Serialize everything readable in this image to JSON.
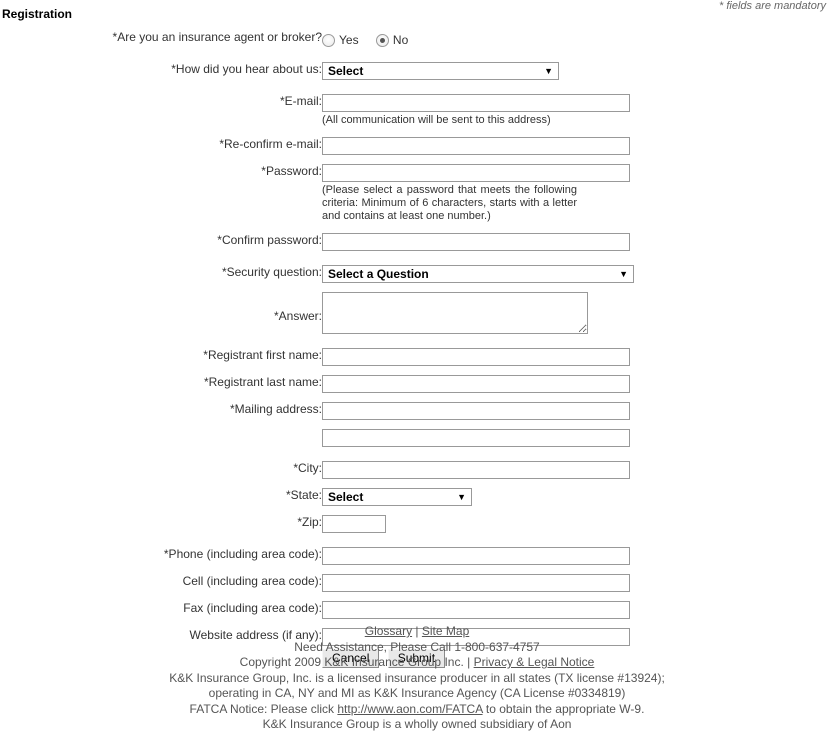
{
  "page": {
    "title": "Registration",
    "mandatory_note": "* fields are mandatory"
  },
  "form": {
    "agent_broker": {
      "label": "*Are you an insurance agent or broker?",
      "options": [
        {
          "label": "Yes",
          "selected": false
        },
        {
          "label": "No",
          "selected": true
        }
      ]
    },
    "hear_about": {
      "label": "*How did you hear about us:",
      "value": "Select"
    },
    "email": {
      "label": "*E-mail:",
      "value": "",
      "hint": "(All communication will be sent to this address)"
    },
    "reconfirm_email": {
      "label": "*Re-confirm e-mail:",
      "value": ""
    },
    "password": {
      "label": "*Password:",
      "value": "",
      "hint": "(Please select a password that meets the following criteria: Minimum of 6 characters, starts with a letter and contains at least one number.)"
    },
    "confirm_password": {
      "label": "*Confirm password:",
      "value": ""
    },
    "security_question": {
      "label": "*Security question:",
      "value": "Select a Question"
    },
    "answer": {
      "label": "*Answer:",
      "value": ""
    },
    "first_name": {
      "label": "*Registrant first name:",
      "value": ""
    },
    "last_name": {
      "label": "*Registrant last name:",
      "value": ""
    },
    "mailing_address": {
      "label": "*Mailing address:",
      "value": "",
      "value2": ""
    },
    "city": {
      "label": "*City:",
      "value": ""
    },
    "state": {
      "label": "*State:",
      "value": "Select"
    },
    "zip": {
      "label": "*Zip:",
      "value": ""
    },
    "phone": {
      "label": "*Phone (including area code):",
      "value": ""
    },
    "cell": {
      "label": "Cell (including area code):",
      "value": ""
    },
    "fax": {
      "label": "Fax (including area code):",
      "value": ""
    },
    "website": {
      "label": "Website address (if any):",
      "value": ""
    },
    "buttons": {
      "cancel": "Cancel",
      "submit": "Submit"
    },
    "select_arrow_icon": "▼"
  },
  "footer": {
    "glossary": "Glossary",
    "separator": "|",
    "site_map": "Site Map",
    "assistance": "Need Assistance, Please Call 1-800-637-4757",
    "copyright": "Copyright 2009 K&K Insurance Group Inc.",
    "copyright_sep": "|",
    "privacy": "Privacy & Legal Notice",
    "license_line1": "K&K Insurance Group, Inc. is a licensed insurance producer in all states (TX license #13924);",
    "license_line2": "operating in CA, NY and MI as K&K Insurance Agency (CA License #0334819)",
    "fatca_prefix": "FATCA Notice: Please click ",
    "fatca_link": "http://www.aon.com/FATCA",
    "fatca_suffix": " to obtain the appropriate W-9.",
    "subsidiary": "K&K Insurance Group is a wholly owned subsidiary of Aon"
  }
}
